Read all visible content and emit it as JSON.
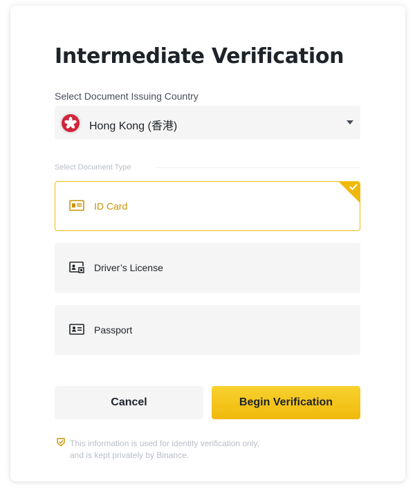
{
  "dialog": {
    "title": "Intermediate Verification",
    "country_label": "Select Document Issuing Country",
    "country": {
      "flag_icon": "hong-kong-flag-icon",
      "name": "Hong Kong (香港)"
    },
    "document_type_label": "Select Document Type",
    "documents": [
      {
        "label": "ID Card",
        "icon": "id-card-icon",
        "selected": true
      },
      {
        "label": "Driver’s License",
        "icon": "drivers-license-icon",
        "selected": false
      },
      {
        "label": "Passport",
        "icon": "passport-icon",
        "selected": false
      }
    ],
    "buttons": {
      "cancel": "Cancel",
      "begin": "Begin Verification"
    },
    "notice": {
      "line1": "This information is used for identity verification only,",
      "line2": "and is kept privately by Binance."
    }
  },
  "colors": {
    "accent": "#f0b90b",
    "accent_text": "#c99400",
    "field_bg": "#f5f5f5",
    "text_primary": "#1e2329",
    "text_muted": "#b7bdc6",
    "flag_red": "#d0263c"
  }
}
